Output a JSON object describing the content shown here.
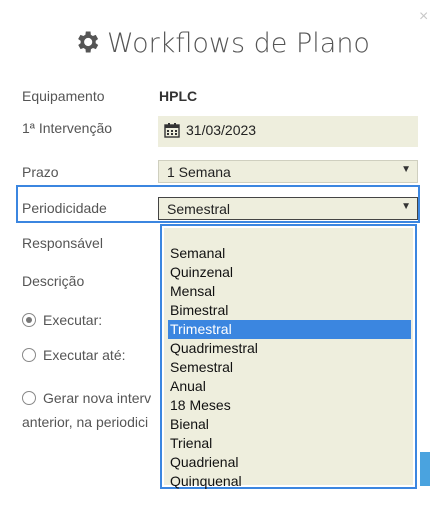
{
  "dialog": {
    "title": "Workflows de Plano",
    "close_glyph": "×"
  },
  "form": {
    "equipamento_label": "Equipamento",
    "equipamento_value": "HPLC",
    "intervencao_label": "1ª Intervenção",
    "intervencao_value": "31/03/2023",
    "prazo_label": "Prazo",
    "prazo_value": "1 Semana",
    "periodicidade_label": "Periodicidade",
    "periodicidade_value": "Semestral",
    "responsavel_label": "Responsável",
    "descricao_label": "Descrição",
    "executar_label": "Executar:",
    "executar_ate_label": "Executar até:",
    "gerar_line1": "Gerar nova interv",
    "gerar_line2": "anterior, na periodici"
  },
  "dropdown": {
    "options": [
      "Semanal",
      "Quinzenal",
      "Mensal",
      "Bimestral",
      "Trimestral",
      "Quadrimestral",
      "Semestral",
      "Anual",
      "18 Meses",
      "Bienal",
      "Trienal",
      "Quadrienal",
      "Quinquenal"
    ],
    "highlighted": "Trimestral"
  },
  "icons": {
    "title_icon": "gear-icon",
    "date_icon": "calendar-icon",
    "select_icon": "chevron-down-icon",
    "close_icon": "close-icon"
  },
  "colors": {
    "field_bg": "#eeeedd",
    "highlight": "#3b86e0"
  }
}
